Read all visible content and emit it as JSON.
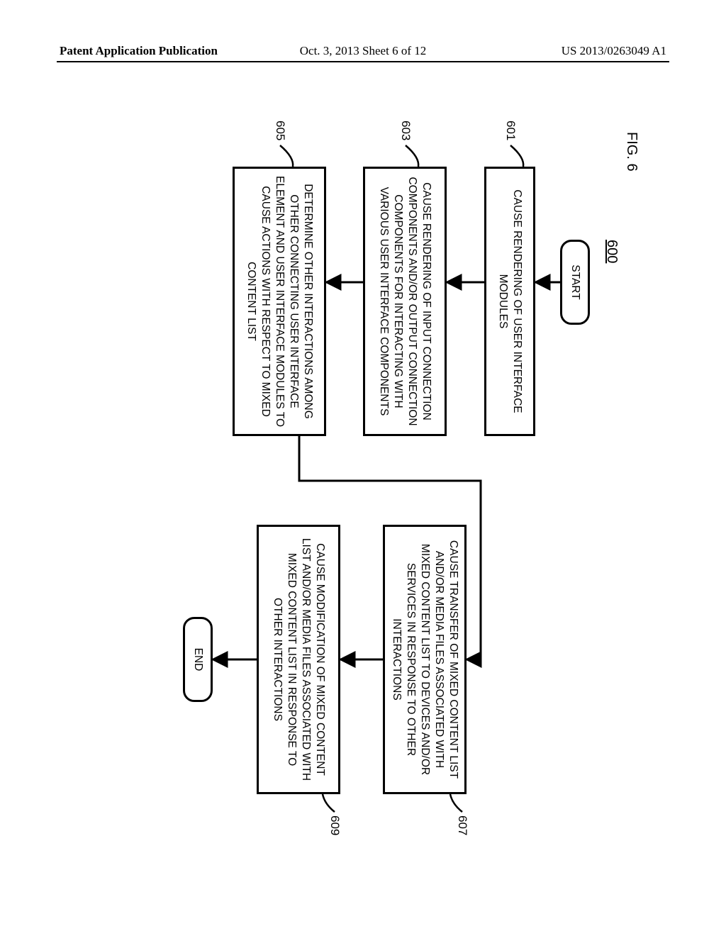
{
  "header": {
    "left": "Patent Application Publication",
    "center": "Oct. 3, 2013   Sheet 6 of 12",
    "right": "US 2013/0263049 A1"
  },
  "figure": {
    "label": "FIG. 6",
    "ref": "600",
    "start": "START",
    "end": "END",
    "steps": {
      "s601": {
        "ref": "601",
        "text": "CAUSE RENDERING OF USER INTERFACE MODULES"
      },
      "s603": {
        "ref": "603",
        "text": "CAUSE RENDERING OF INPUT CONNECTION COMPONENTS AND/OR OUTPUT CONNECTION COMPONENTS FOR INTERACTING WITH VARIOUS USER INTERFACE COMPONENTS"
      },
      "s605": {
        "ref": "605",
        "text": "DETERMINE OTHER INTERACTIONS AMONG OTHER CONNECTING USER INTERFACE ELEMENT AND USER INTERFACE MODULES TO CAUSE ACTIONS WITH RESPECT TO MIXED CONTENT LIST"
      },
      "s607": {
        "ref": "607",
        "text": "CAUSE TRANSFER OF MIXED CONTENT LIST AND/OR MEDIA FILES ASSOCIATED WITH MIXED CONTENT LIST TO DEVICES AND/OR SERVICES IN RESPONSE TO OTHER INTERACTIONS"
      },
      "s609": {
        "ref": "609",
        "text": "CAUSE MODIFICATION OF MIXED CONTENT LIST AND/OR MEDIA FILES ASSOCIATED WITH MIXED CONTENT LIST IN RESPONSE TO OTHER INTERACTIONS"
      }
    }
  },
  "chart_data": {
    "type": "flowchart",
    "title": "FIG. 6",
    "ref": "600",
    "nodes": [
      {
        "id": "start",
        "kind": "terminator",
        "label": "START"
      },
      {
        "id": "601",
        "kind": "process",
        "label": "CAUSE RENDERING OF USER INTERFACE MODULES"
      },
      {
        "id": "603",
        "kind": "process",
        "label": "CAUSE RENDERING OF INPUT CONNECTION COMPONENTS AND/OR OUTPUT CONNECTION COMPONENTS FOR INTERACTING WITH VARIOUS USER INTERFACE COMPONENTS"
      },
      {
        "id": "605",
        "kind": "process",
        "label": "DETERMINE OTHER INTERACTIONS AMONG OTHER CONNECTING USER INTERFACE ELEMENT AND USER INTERFACE MODULES TO CAUSE ACTIONS WITH RESPECT TO MIXED CONTENT LIST"
      },
      {
        "id": "607",
        "kind": "process",
        "label": "CAUSE TRANSFER OF MIXED CONTENT LIST AND/OR MEDIA FILES ASSOCIATED WITH MIXED CONTENT LIST TO DEVICES AND/OR SERVICES IN RESPONSE TO OTHER INTERACTIONS"
      },
      {
        "id": "609",
        "kind": "process",
        "label": "CAUSE MODIFICATION OF MIXED CONTENT LIST AND/OR MEDIA FILES ASSOCIATED WITH MIXED CONTENT LIST IN RESPONSE TO OTHER INTERACTIONS"
      },
      {
        "id": "end",
        "kind": "terminator",
        "label": "END"
      }
    ],
    "edges": [
      {
        "from": "start",
        "to": "601"
      },
      {
        "from": "601",
        "to": "603"
      },
      {
        "from": "603",
        "to": "605"
      },
      {
        "from": "605",
        "to": "607",
        "note": "elbow right then down to 607"
      },
      {
        "from": "607",
        "to": "609"
      },
      {
        "from": "609",
        "to": "end"
      }
    ]
  }
}
